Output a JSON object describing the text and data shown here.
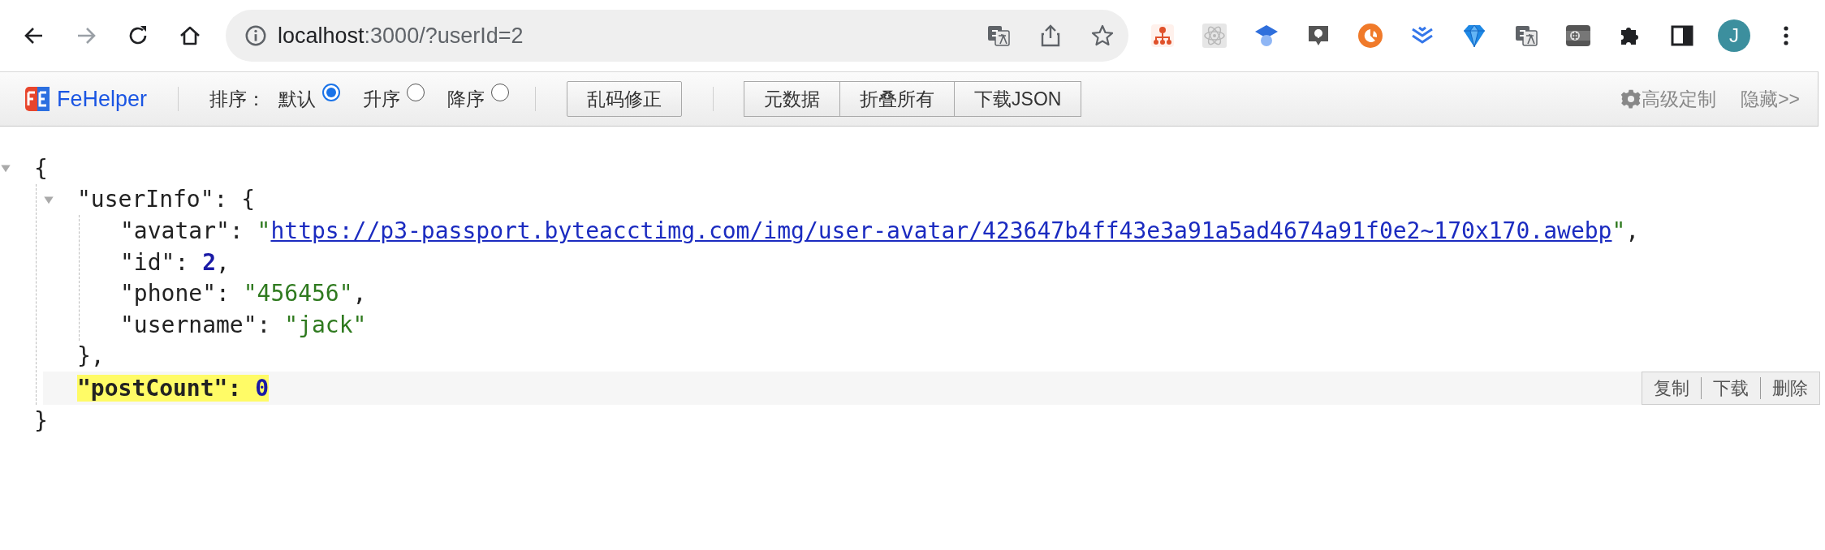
{
  "browser": {
    "nav": [
      {
        "kind": "back",
        "disabled": false
      },
      {
        "kind": "forward",
        "disabled": true
      },
      {
        "kind": "reload",
        "disabled": false
      },
      {
        "kind": "home",
        "disabled": false
      }
    ],
    "address": {
      "host": "localhost",
      "path": ":3000/?userId=2"
    },
    "address_actions": [
      {
        "kind": "translate"
      },
      {
        "kind": "share"
      },
      {
        "kind": "star"
      }
    ],
    "extensions": [
      {
        "kind": "sitemap"
      },
      {
        "kind": "atom"
      },
      {
        "kind": "cap"
      },
      {
        "kind": "chat"
      },
      {
        "kind": "pie"
      },
      {
        "kind": "chevrons"
      },
      {
        "kind": "gem"
      },
      {
        "kind": "translate"
      },
      {
        "kind": "keyboard"
      },
      {
        "kind": "puzzle"
      },
      {
        "kind": "sidebar"
      }
    ],
    "profile": {
      "initial": "J"
    }
  },
  "fehelper": {
    "brand": "FeHelper",
    "sort_label": "排序：",
    "sort_options": [
      {
        "label": "默认",
        "selected": true
      },
      {
        "label": "升序",
        "selected": false
      },
      {
        "label": "降序",
        "selected": false
      }
    ],
    "fix_button": "乱码修正",
    "buttons": [
      "元数据",
      "折叠所有",
      "下载JSON"
    ],
    "settings": "高级定制",
    "hide": "隐藏>>"
  },
  "json_view": {
    "open": "{",
    "expanded": true,
    "close": "}",
    "children": [
      {
        "key": "\"userInfo\":",
        "open": "{",
        "expanded": true,
        "close": "},",
        "selected": false,
        "children": [
          {
            "key": "\"avatar\":",
            "kind": "link",
            "value": "\"https://p3-passport.byteacctimg.com/img/user-avatar/423647b4ff43e3a91a5ad4674a91f0e2~170x170.awebp\"",
            "tail": ",",
            "selected": false
          },
          {
            "key": "\"id\":",
            "kind": "number",
            "value": "2",
            "tail": ",",
            "selected": false
          },
          {
            "key": "\"phone\":",
            "kind": "string",
            "value": "\"456456\"",
            "tail": ",",
            "selected": false
          },
          {
            "key": "\"username\":",
            "kind": "string",
            "value": "\"jack\"",
            "selected": false
          }
        ]
      },
      {
        "key": "\"postCount\":",
        "kind": "number",
        "value": "0",
        "selected": true,
        "actions": [
          "复制",
          "下载",
          "删除"
        ]
      }
    ]
  }
}
